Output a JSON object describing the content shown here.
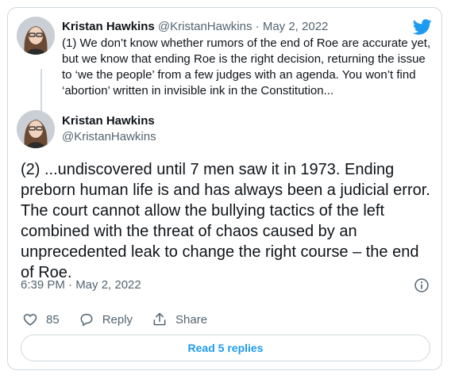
{
  "quoted_tweet": {
    "author_name": "Kristan Hawkins",
    "author_handle": "@KristanHawkins",
    "separator": "·",
    "date": "May 2, 2022",
    "text": "(1) We don’t know whether rumors of the end of Roe are accurate yet, but we know that ending Roe is the right decision, returning the issue to ‘we the people’ from a few judges with an agenda. You won’t find ‘abortion’ written in invisible ink in the Constitution..."
  },
  "main_tweet": {
    "author_name": "Kristan Hawkins",
    "author_handle": "@KristanHawkins",
    "text": "(2) ...undiscovered until 7 men saw it in 1973. Ending preborn human life is and has always been a judicial error. The court cannot allow the bullying tactics of the left combined with the threat of chaos caused by an unprecedented leak to change the right course – the end of Roe.",
    "timestamp": "6:39 PM · May 2, 2022"
  },
  "actions": {
    "like_count": "85",
    "reply_label": "Reply",
    "share_label": "Share"
  },
  "read_replies_label": "Read 5 replies",
  "colors": {
    "accent": "#1d9bf0",
    "muted_text": "#536471",
    "border": "#cfd9de"
  },
  "icons": [
    "twitter-logo-icon",
    "info-icon",
    "heart-icon",
    "reply-icon",
    "share-icon"
  ]
}
